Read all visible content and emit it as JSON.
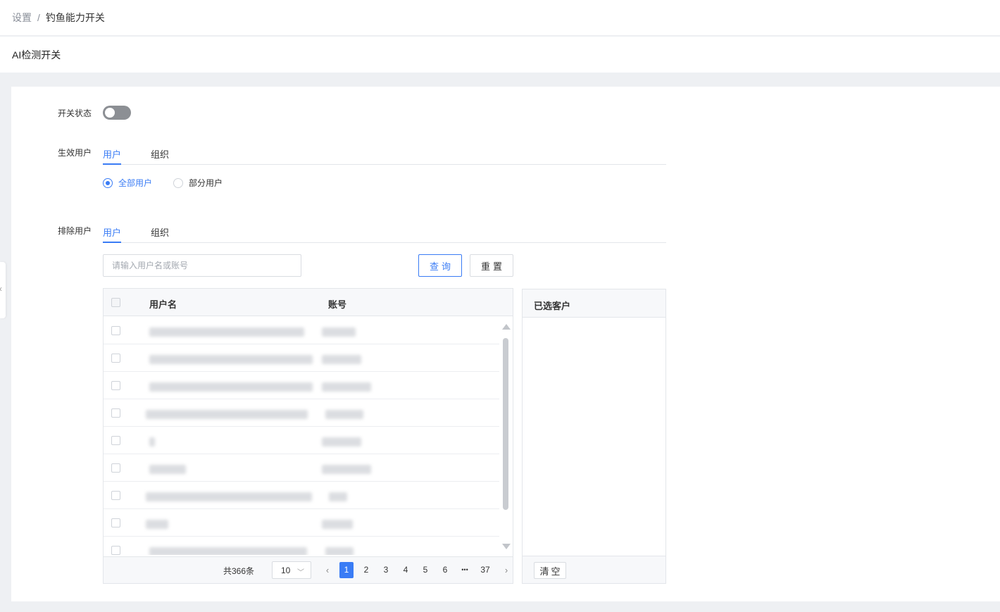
{
  "breadcrumb": {
    "parent": "设置",
    "separator": "/",
    "current": "钓鱼能力开关"
  },
  "section_title": "AI检测开关",
  "form": {
    "switch_label": "开关状态",
    "switch_on": false,
    "effective_label": "生效用户",
    "effective_tabs": [
      "用户",
      "组织"
    ],
    "radio_all": "全部用户",
    "radio_partial": "部分用户",
    "exclude_label": "排除用户",
    "exclude_tabs": [
      "用户",
      "组织"
    ]
  },
  "search": {
    "placeholder": "请输入用户名或账号",
    "query_label": "查询",
    "reset_label": "重置"
  },
  "table": {
    "col_username": "用户名",
    "col_account": "账号",
    "rows": [
      "",
      "",
      "",
      "",
      "",
      "",
      "",
      "",
      ""
    ]
  },
  "pagination": {
    "total": "共366条",
    "page_size": "10",
    "pages": [
      "1",
      "2",
      "3",
      "4",
      "5",
      "6"
    ],
    "ellipsis": "•••",
    "last_page": "37",
    "current_page": "1"
  },
  "selected": {
    "title": "已选客户",
    "clear_label": "清空"
  },
  "colors": {
    "accent": "#3a7cf5",
    "switch_off": "#8c8f94"
  },
  "icons": {
    "prev": "chevron-left-icon",
    "next": "chevron-right-icon",
    "dropdown": "chevron-down-icon",
    "collapse": "chevron-left-icon"
  }
}
